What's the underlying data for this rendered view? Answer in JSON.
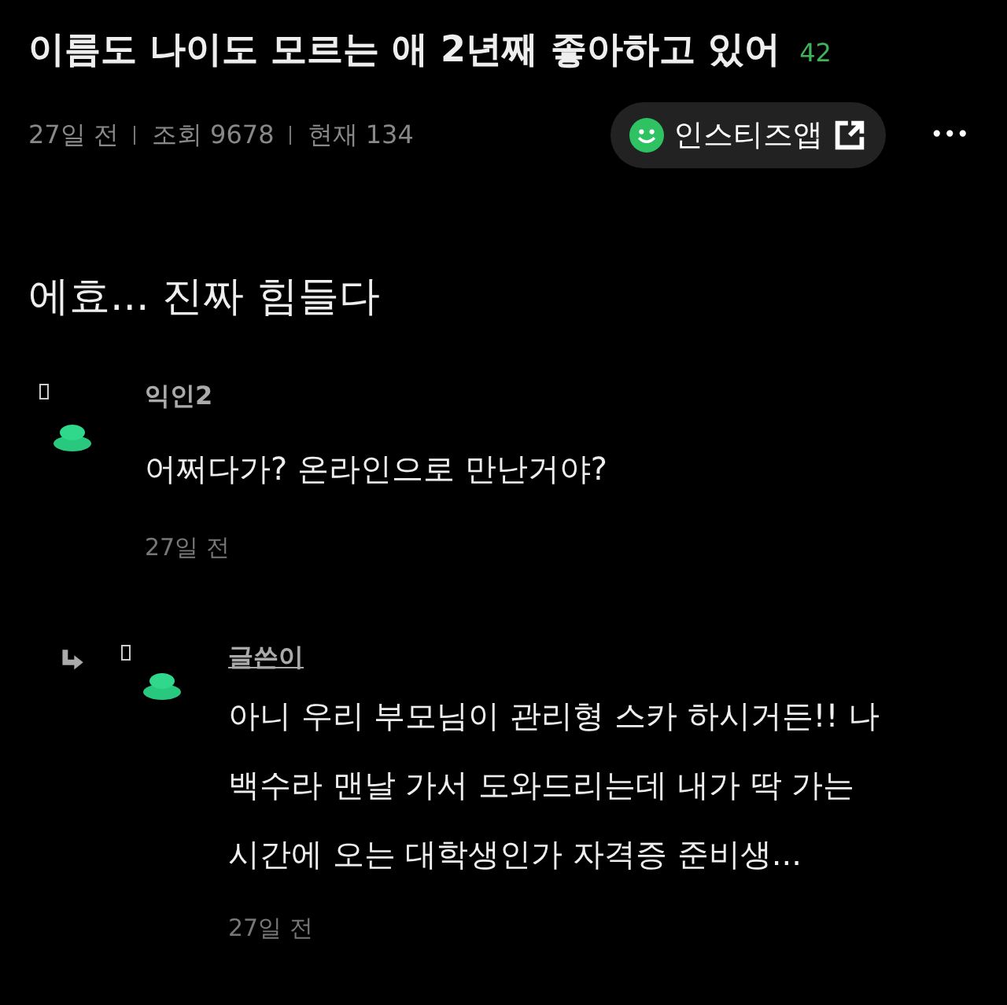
{
  "post": {
    "title": "이름도 나이도 모르는 애 2년째 좋아하고 있어",
    "comment_count": "42",
    "meta": [
      "27일 전",
      "조회 9678",
      "현재 134"
    ],
    "app_button": "인스티즈앱",
    "more": "•••",
    "body": "에효... 진짜 힘들다"
  },
  "comments": [
    {
      "kind": "comment",
      "author": "익인2",
      "is_author": false,
      "lines": [
        "어쩌다가? 온라인으로 만난거야?"
      ],
      "time": "27일 전"
    },
    {
      "kind": "reply",
      "author": "글쓴이",
      "is_author": true,
      "lines": [
        "아니 우리 부모님이 관리형 스카 하시거든!! 나",
        "백수라 맨날 가서 도와드리는데 내가 딱 가는",
        "시간에 오는 대학생인가 자격증 준비생..."
      ],
      "time": "27일 전"
    }
  ]
}
